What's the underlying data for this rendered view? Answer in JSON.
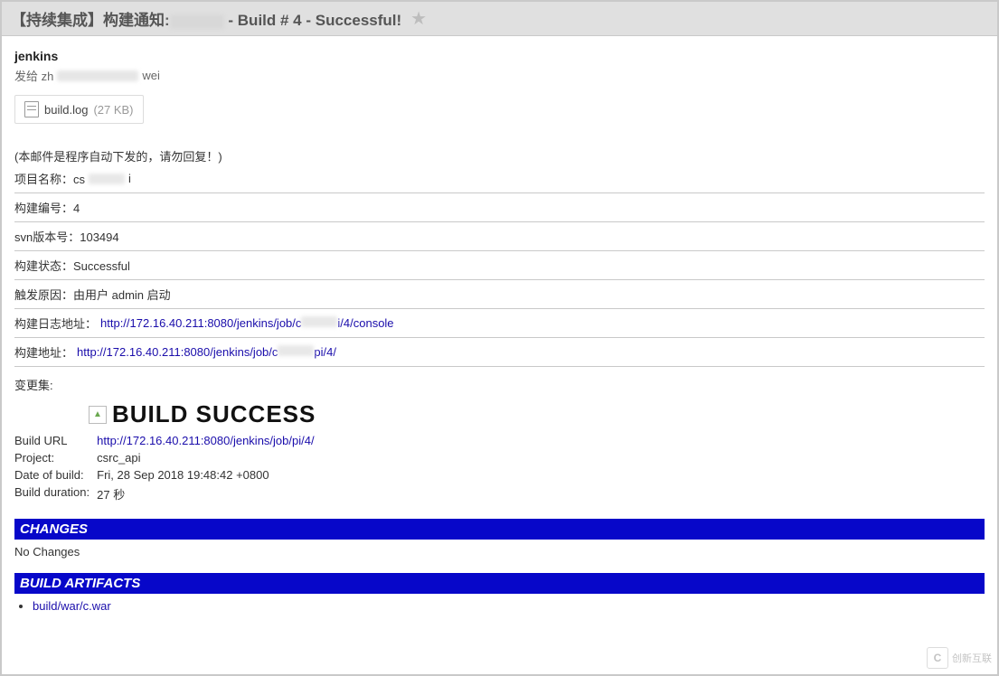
{
  "title": {
    "prefix": "【持续集成】构建通知:",
    "suffix": " - Build # 4 - Successful!"
  },
  "sender": "jenkins",
  "recipient_prefix": "发给 zh",
  "recipient_suffix": "wei",
  "attachment": {
    "name": "build.log",
    "size": "(27 KB)"
  },
  "notice": "(本邮件是程序自动下发的，请勿回复！)",
  "rows": {
    "project_label": "项目名称：cs",
    "project_suffix": "i",
    "build_no": "构建编号：4",
    "svn": "svn版本号：103494",
    "status": "构建状态：Successful",
    "cause": "触发原因：由用户 admin 启动",
    "log_label": "构建日志地址：",
    "log_url_pre": "http://172.16.40.211:8080/jenkins/job/c",
    "log_url_post": "i/4/console",
    "addr_label": "构建地址：",
    "addr_url_pre": "http://172.16.40.211:8080/jenkins/job/c",
    "addr_url_post": "pi/4/",
    "changes_label": "变更集:"
  },
  "success": {
    "heading": "BUILD SUCCESS",
    "build_url_label": "Build URL",
    "build_url_pre": "http://172.16.40.211:8080/jenkins/job/",
    "build_url_post": "pi/4/",
    "project_label": "Project:",
    "project_value": "csrc_api",
    "date_label": "Date of build:",
    "date_value": "Fri, 28 Sep 2018 19:48:42 +0800",
    "duration_label": "Build duration:",
    "duration_value": "27 秒"
  },
  "changes": {
    "banner": "CHANGES",
    "text": "No Changes"
  },
  "artifacts": {
    "banner": "BUILD ARTIFACTS",
    "item_pre": "build/war/c",
    "item_post": ".war"
  },
  "watermark": "创新互联"
}
